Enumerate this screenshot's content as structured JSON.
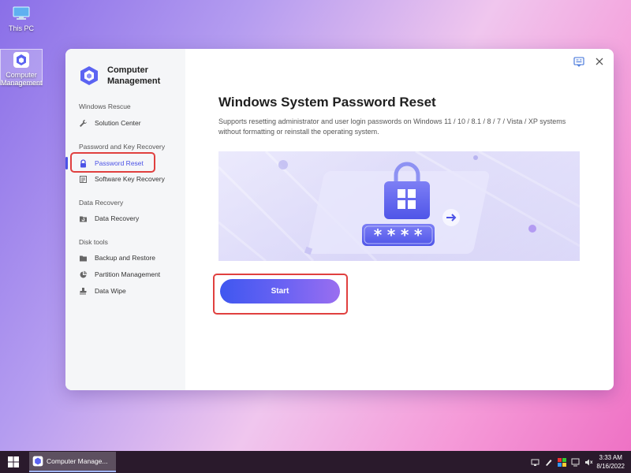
{
  "desktop": {
    "icons": [
      {
        "label": "This PC"
      },
      {
        "label": "Computer Management"
      }
    ]
  },
  "app": {
    "brand_line1": "Computer",
    "brand_line2": "Management",
    "sections": [
      {
        "title": "Windows Rescue",
        "items": [
          {
            "label": "Solution Center",
            "icon": "wrench-icon"
          }
        ]
      },
      {
        "title": "Password and Key Recovery",
        "items": [
          {
            "label": "Password Reset",
            "icon": "lock-icon",
            "active": true
          },
          {
            "label": "Software Key Recovery",
            "icon": "key-list-icon"
          }
        ]
      },
      {
        "title": "Data Recovery",
        "items": [
          {
            "label": "Data Recovery",
            "icon": "folder-recovery-icon"
          }
        ]
      },
      {
        "title": "Disk tools",
        "items": [
          {
            "label": "Backup and Restore",
            "icon": "folder-icon"
          },
          {
            "label": "Partition Management",
            "icon": "pie-chart-icon"
          },
          {
            "label": "Data Wipe",
            "icon": "wipe-icon"
          }
        ]
      }
    ],
    "main": {
      "title": "Windows System Password Reset",
      "description": "Supports resetting administrator and user login passwords on Windows 11 / 10 / 8.1 / 8 / 7 / Vista / XP systems without formatting or reinstall the operating system.",
      "password_mask": "****",
      "start_label": "Start"
    },
    "accent_color": "#4b52e6",
    "highlight_color": "#e0403f"
  },
  "taskbar": {
    "task_label": "Computer Manage...",
    "time": "3:33 AM",
    "date": "8/16/2022"
  }
}
